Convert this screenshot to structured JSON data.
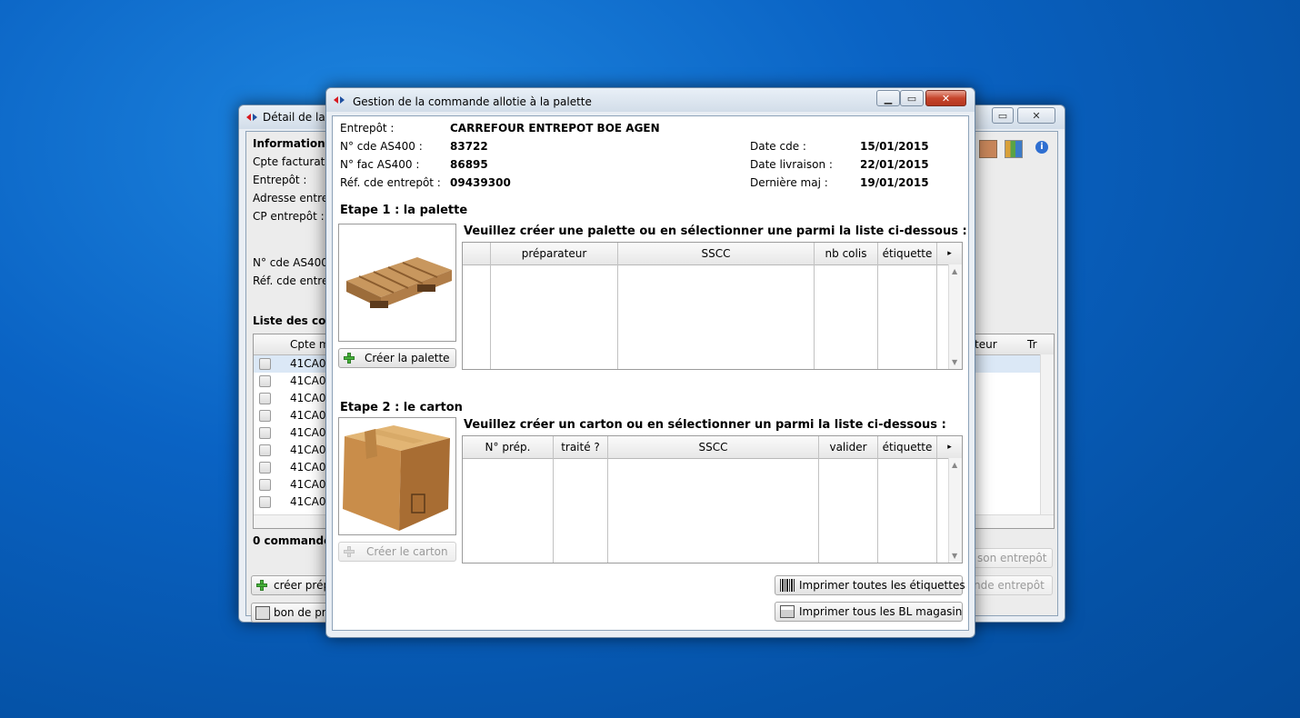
{
  "back_window": {
    "title": "Détail de la c",
    "labels": {
      "informations": "Informations",
      "cpte_facturation": "Cpte facturatio",
      "entrepot": "Entrepôt :",
      "adresse": "Adresse entre",
      "cp": "CP entrepôt :",
      "ncde": "N° cde AS400",
      "refcde": "Réf. cde entre",
      "liste": "Liste des co",
      "count": "0 commande"
    },
    "table": {
      "header_col1": "Cpte m",
      "header_right1": "teur",
      "header_right2": "Tr",
      "rows": [
        "41CA0",
        "41CA0",
        "41CA0",
        "41CA0",
        "41CA0",
        "41CA0",
        "41CA0",
        "41CA0",
        "41CA0"
      ]
    },
    "buttons": {
      "creer_prep": "créer prép",
      "bon_prep": "bon de pre",
      "saison": "son entrepôt",
      "commande": "nde entrepôt"
    }
  },
  "front_window": {
    "title": "Gestion de la commande allotie à la palette",
    "fields": {
      "entrepot_label": "Entrepôt :",
      "entrepot_value": "CARREFOUR ENTREPOT BOE AGEN",
      "ncde_label": "N° cde AS400 :",
      "ncde_value": "83722",
      "nfac_label": "N° fac AS400 :",
      "nfac_value": "86895",
      "ref_label": "Réf. cde entrepôt :",
      "ref_value": "09439300",
      "datecde_label": "Date cde :",
      "datecde_value": "15/01/2015",
      "dateliv_label": "Date livraison :",
      "dateliv_value": "22/01/2015",
      "majlabel": "Dernière maj :",
      "maj_value": "19/01/2015"
    },
    "step1": {
      "title": "Etape 1 : la palette",
      "instruction": "Veuillez créer une palette ou en sélectionner une parmi la liste ci-dessous :",
      "button": "Créer la palette",
      "columns": [
        "",
        "préparateur",
        "SSCC",
        "nb colis",
        "étiquette"
      ]
    },
    "step2": {
      "title": "Etape 2 : le carton",
      "instruction": "Veuillez créer un carton ou en sélectionner un parmi la liste ci-dessous :",
      "button": "Créer le carton",
      "columns": [
        "N° prép.",
        "traité ?",
        "SSCC",
        "valider",
        "étiquette"
      ]
    },
    "print_labels": "Imprimer toutes les étiquettes",
    "print_bl": "Imprimer tous les BL magasin"
  }
}
